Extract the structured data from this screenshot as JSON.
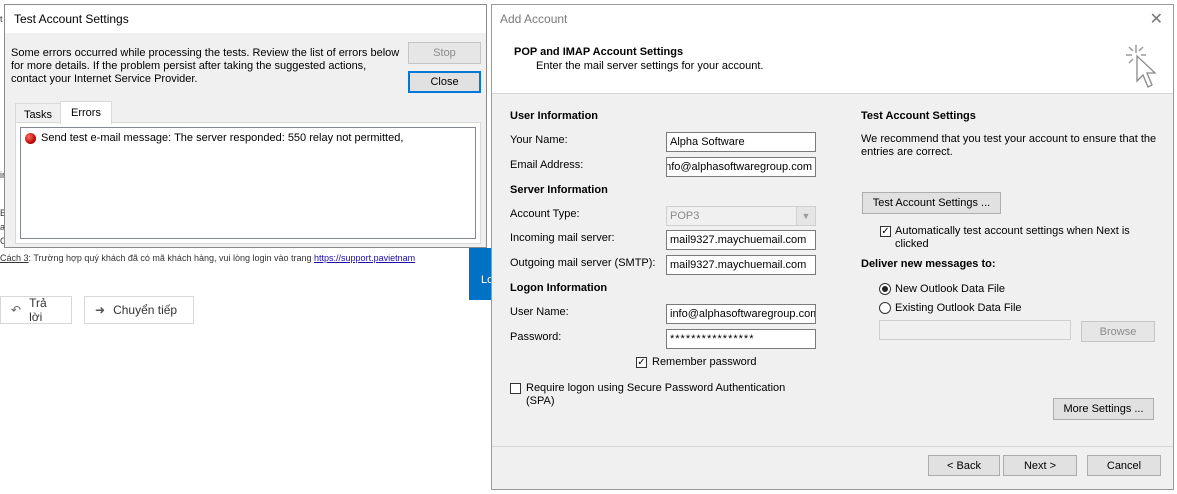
{
  "background": {
    "fragments": [
      "t",
      "ir",
      "B",
      "a",
      "C"
    ],
    "footer_note_prefix": "Cách 3",
    "footer_note_text": ": Trường hợp quý khách đã có mã khách hàng, vui lòng login vào trang ",
    "footer_note_link": "https://support.pavietnam",
    "reply_label": "Trả lời",
    "forward_label": "Chuyển tiếp",
    "blue_tile_text": "Lo",
    "right_edge_fragment": "n",
    "accent_color": "#0072c6"
  },
  "test_dialog": {
    "title": "Test Account Settings",
    "message": "Some errors occurred while processing the tests. Review the list of errors below for more details. If the problem persist after taking the suggested actions, contact your Internet Service Provider.",
    "stop_label": "Stop",
    "close_label": "Close",
    "tabs": [
      {
        "label": "Tasks",
        "selected": false
      },
      {
        "label": "Errors",
        "selected": true
      }
    ],
    "errors": [
      {
        "icon": "error-icon",
        "text": "Send test e-mail message:   The server responded: 550 relay not permitted,"
      }
    ]
  },
  "add_account": {
    "title": "Add Account",
    "heading": "POP and IMAP Account Settings",
    "subheading": "Enter the mail server settings for your account.",
    "user_info": {
      "section": "User Information",
      "name_label": "Your Name:",
      "name_value": "Alpha Software",
      "email_label": "Email Address:",
      "email_value": "info@alphasoftwaregroup.com"
    },
    "server_info": {
      "section": "Server Information",
      "account_type_label": "Account Type:",
      "account_type_value": "POP3",
      "incoming_label": "Incoming mail server:",
      "incoming_value": "mail9327.maychuemail.com",
      "outgoing_label": "Outgoing mail server (SMTP):",
      "outgoing_value": "mail9327.maychuemail.com"
    },
    "logon_info": {
      "section": "Logon Information",
      "username_label": "User Name:",
      "username_value": "info@alphasoftwaregroup.com",
      "password_label": "Password:",
      "password_value": "****************",
      "remember_label": "Remember password",
      "remember_checked": true,
      "spa_label": "Require logon using Secure Password Authentication (SPA)",
      "spa_checked": false
    },
    "test_settings": {
      "section": "Test Account Settings",
      "description": "We recommend that you test your account to ensure that the entries are correct.",
      "test_button": "Test Account Settings ...",
      "auto_test_label": "Automatically test account settings when Next is clicked",
      "auto_test_checked": true
    },
    "deliver": {
      "section": "Deliver new messages to:",
      "new_file_label": "New Outlook Data File",
      "existing_file_label": "Existing Outlook Data File",
      "selected": "new",
      "file_path": "",
      "browse_label": "Browse"
    },
    "more_settings_label": "More Settings ...",
    "back_label": "< Back",
    "next_label": "Next >",
    "cancel_label": "Cancel"
  }
}
